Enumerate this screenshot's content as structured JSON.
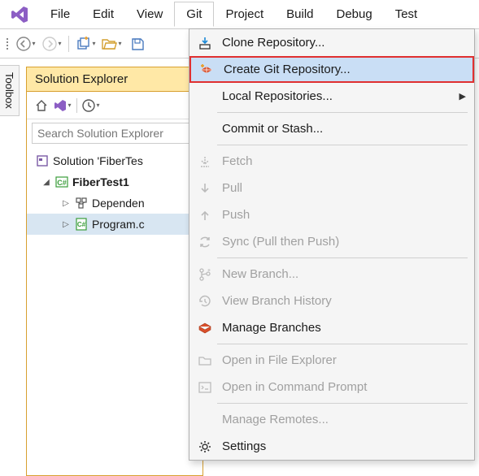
{
  "menubar": {
    "items": [
      "File",
      "Edit",
      "View",
      "Git",
      "Project",
      "Build",
      "Debug",
      "Test"
    ],
    "active_index": 3
  },
  "sidebar_tab": "Toolbox",
  "solution_explorer": {
    "title": "Solution Explorer",
    "search_placeholder": "Search Solution Explorer",
    "tree": {
      "solution": "Solution 'FiberTes",
      "project": "FiberTest1",
      "dependencies": "Dependen",
      "program": "Program.c"
    }
  },
  "git_menu": {
    "clone": "Clone Repository...",
    "create": "Create Git Repository...",
    "local": "Local Repositories...",
    "commit": "Commit or Stash...",
    "fetch": "Fetch",
    "pull": "Pull",
    "push": "Push",
    "sync": "Sync (Pull then Push)",
    "new_branch": "New Branch...",
    "history": "View Branch History",
    "manage_branches": "Manage Branches",
    "explorer": "Open in File Explorer",
    "cmd": "Open in Command Prompt",
    "remotes": "Manage Remotes...",
    "settings": "Settings"
  }
}
